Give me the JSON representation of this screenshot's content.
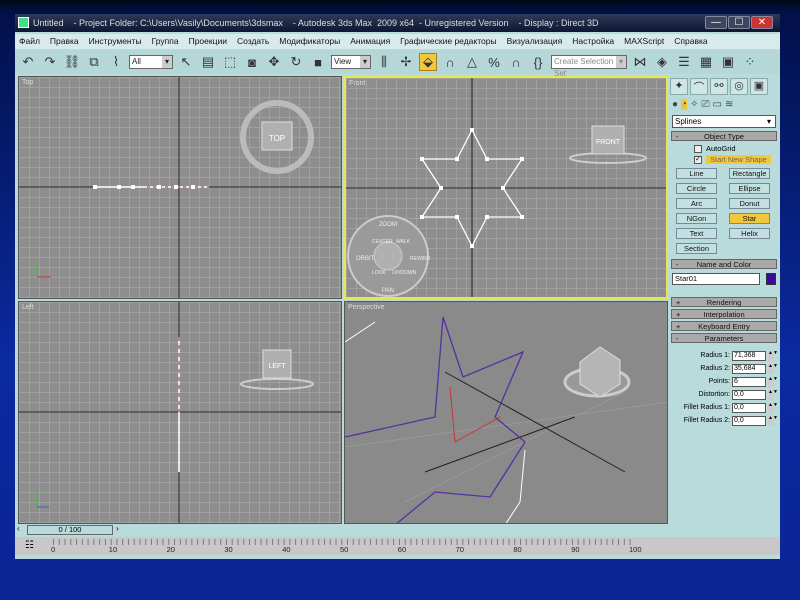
{
  "title": {
    "text": "Untitled    - Project Folder: C:\\Users\\Vasily\\Documents\\3dsmax    - Autodesk 3ds Max  2009 x64  - Unregistered Version    - Display : Direct 3D",
    "min": "—",
    "max": "☐",
    "close": "✕"
  },
  "menu": [
    "Файл",
    "Правка",
    "Инструменты",
    "Группа",
    "Проекции",
    "Создать",
    "Модификаторы",
    "Анимация",
    "Графические редакторы",
    "Визуализация",
    "Настройка",
    "MAXScript",
    "Справка"
  ],
  "toolbar": {
    "filter": "All",
    "refcoord": "View",
    "selection_set": "Create Selection Set"
  },
  "viewports": {
    "top": "Top",
    "front": "Front",
    "left": "Left",
    "perspective": "Perspective",
    "cube_top": "TOP",
    "cube_front": "FRONT",
    "cube_left": "LEFT",
    "wheel": [
      "ZOOM",
      "ORBIT",
      "CENTER",
      "WALK",
      "REWIND",
      "LOOK",
      "UP/DOWN",
      "PAN"
    ]
  },
  "panel": {
    "category": "Splines",
    "object_type": "Object Type",
    "autogrid": "AutoGrid",
    "start_new_shape": "Start New Shape",
    "buttons": [
      "Line",
      "Rectangle",
      "Circle",
      "Ellipse",
      "Arc",
      "Donut",
      "NGon",
      "Star",
      "Text",
      "Helix",
      "Section"
    ],
    "active_button": "Star",
    "name_and_color": "Name and Color",
    "name": "Star01",
    "color": "#3a0a9a",
    "rendering": "Rendering",
    "interpolation": "Interpolation",
    "keyboard_entry": "Keyboard Entry",
    "parameters": "Parameters",
    "params": [
      {
        "label": "Radius 1:",
        "value": "71,368"
      },
      {
        "label": "Radius 2:",
        "value": "35,684"
      },
      {
        "label": "Points:",
        "value": "6"
      },
      {
        "label": "Distortion:",
        "value": "0,0"
      },
      {
        "label": "Fillet Radius 1:",
        "value": "0,0"
      },
      {
        "label": "Fillet Radius 2:",
        "value": "0,0"
      }
    ]
  },
  "timeline": {
    "slider": "0 / 100",
    "ticks": [
      "0",
      "10",
      "20",
      "30",
      "40",
      "50",
      "60",
      "70",
      "80",
      "90",
      "100"
    ]
  }
}
